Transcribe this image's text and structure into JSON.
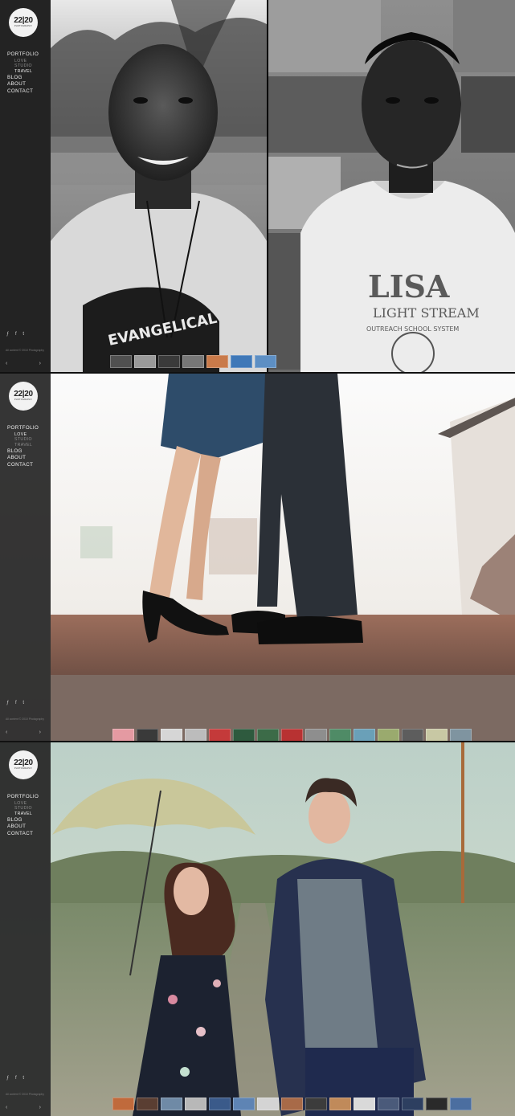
{
  "site": {
    "logo_number": "22|20",
    "logo_sub": "PHOTOGRAPHY",
    "nav": [
      {
        "label": "PORTFOLIO"
      },
      {
        "label": "BLOG"
      },
      {
        "label": "ABOUT"
      },
      {
        "label": "CONTACT"
      }
    ],
    "portfolio_sub": [
      "LOVE",
      "STUDIO",
      "TRAVEL"
    ],
    "social_icons": [
      "feed-icon",
      "facebook-icon",
      "twitter-icon"
    ],
    "social_glyphs": "ƒ f t",
    "copyright": "All content © 2010 Photography",
    "prev_arrow": "‹",
    "next_arrow": "›"
  },
  "screens": [
    {
      "active_sub": "TRAVEL",
      "thumbnail_count": 7,
      "photo_subjects": [
        "smiling-old-man-bw-photo",
        "boy-lisa-shirt-photo"
      ],
      "shirt_text_left": "EVANGELICAL",
      "shirt_text_right_1": "LISA",
      "shirt_text_right_2": "LIGHT STREAM",
      "shirt_text_right_3": "OUTREACH SCHOOL SYSTEM"
    },
    {
      "active_sub": "LOVE",
      "thumbnail_count": 15,
      "photo_subjects": [
        "couple-shoes-photo"
      ]
    },
    {
      "active_sub": "TRAVEL",
      "thumbnail_count": 15,
      "photo_subjects": [
        "couple-umbrella-railroad-photo"
      ]
    }
  ],
  "colors": {
    "sidebar_bg": "#262626",
    "nav_text": "#f0f0f0",
    "nav_sub_inactive": "#8c8c8c"
  }
}
